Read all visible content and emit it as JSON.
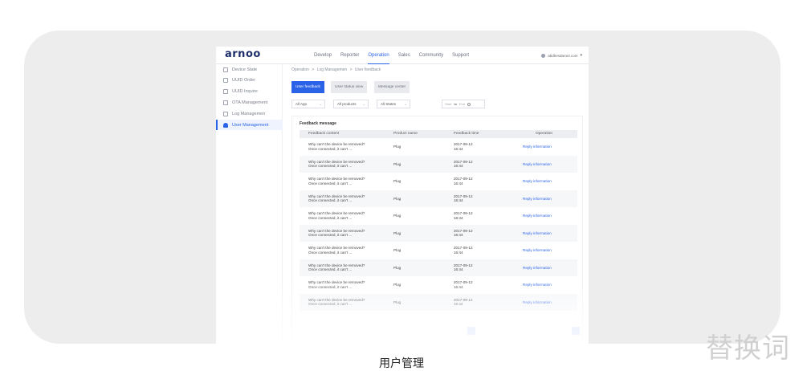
{
  "header": {
    "logo": "arnoo",
    "nav": [
      "Develop",
      "Reporter",
      "Operation",
      "Sales",
      "Community",
      "Support"
    ],
    "active_nav": "Operation",
    "user_email": "abdhesdaronr.com"
  },
  "sidebar": {
    "items": [
      {
        "label": "Device State",
        "icon": "device-icon"
      },
      {
        "label": "UUID Order",
        "icon": "order-icon"
      },
      {
        "label": "UUID Inquire",
        "icon": "inquire-icon"
      },
      {
        "label": "OTA Management",
        "icon": "grid-icon"
      },
      {
        "label": "Log Managemen",
        "icon": "log-icon"
      },
      {
        "label": "User Management",
        "icon": "user-icon"
      }
    ],
    "active": "User Management"
  },
  "breadcrumb": [
    "Operation",
    ">",
    "Log Managemen",
    ">",
    "User feedback"
  ],
  "tabs": [
    "User feedback",
    "User status view",
    "Message center"
  ],
  "active_tab": "User feedback",
  "filters": {
    "app": "All App",
    "products": "All products",
    "states": "All States",
    "date_start": "Start",
    "date_to": "to",
    "date_end": "End"
  },
  "panel": {
    "title": "Feedback message",
    "columns": [
      "Feedback content",
      "Product name",
      "Feedback time",
      "Operation"
    ],
    "rows": [
      {
        "content1": "Why can't the device be removed?",
        "content2": "Once connected, it can't ...",
        "product": "Plug",
        "date": "2017-09-12",
        "time": "16:44",
        "op": "Reply information"
      },
      {
        "content1": "Why can't the device be removed?",
        "content2": "Once connected, it can't ...",
        "product": "Plug",
        "date": "2017-09-12",
        "time": "16:44",
        "op": "Reply information"
      },
      {
        "content1": "Why can't the device be removed?",
        "content2": "Once connected, it can't ...",
        "product": "Plug",
        "date": "2017-09-12",
        "time": "16:44",
        "op": "Reply information"
      },
      {
        "content1": "Why can't the device be removed?",
        "content2": "Once connected, it can't ...",
        "product": "Plug",
        "date": "2017-09-12",
        "time": "16:44",
        "op": "Reply information"
      },
      {
        "content1": "Why can't the device be removed?",
        "content2": "Once connected, it can't ...",
        "product": "Plug",
        "date": "2017-09-12",
        "time": "16:44",
        "op": "Reply information"
      },
      {
        "content1": "Why can't the device be removed?",
        "content2": "Once connected, it can't ...",
        "product": "Plug",
        "date": "2017-09-12",
        "time": "16:44",
        "op": "Reply information"
      },
      {
        "content1": "Why can't the device be removed?",
        "content2": "Once connected, it can't ...",
        "product": "Plug",
        "date": "2017-09-12",
        "time": "16:44",
        "op": "Reply information"
      },
      {
        "content1": "Why can't the device be removed?",
        "content2": "Once connected, it can't ...",
        "product": "Plug",
        "date": "2017-09-12",
        "time": "16:44",
        "op": "Reply information"
      },
      {
        "content1": "Why can't the device be removed?",
        "content2": "Once connected, it can't ...",
        "product": "Plug",
        "date": "2017-09-12",
        "time": "16:44",
        "op": "Reply information"
      },
      {
        "content1": "Why can't the device be removed?",
        "content2": "Once connected, it can't ...",
        "product": "Plug",
        "date": "2017-09-12",
        "time": "16:44",
        "op": "Reply information"
      }
    ]
  },
  "caption": "用户管理",
  "watermark": "替换词",
  "colors": {
    "accent": "#2b63e8",
    "stage": "#ededee"
  }
}
